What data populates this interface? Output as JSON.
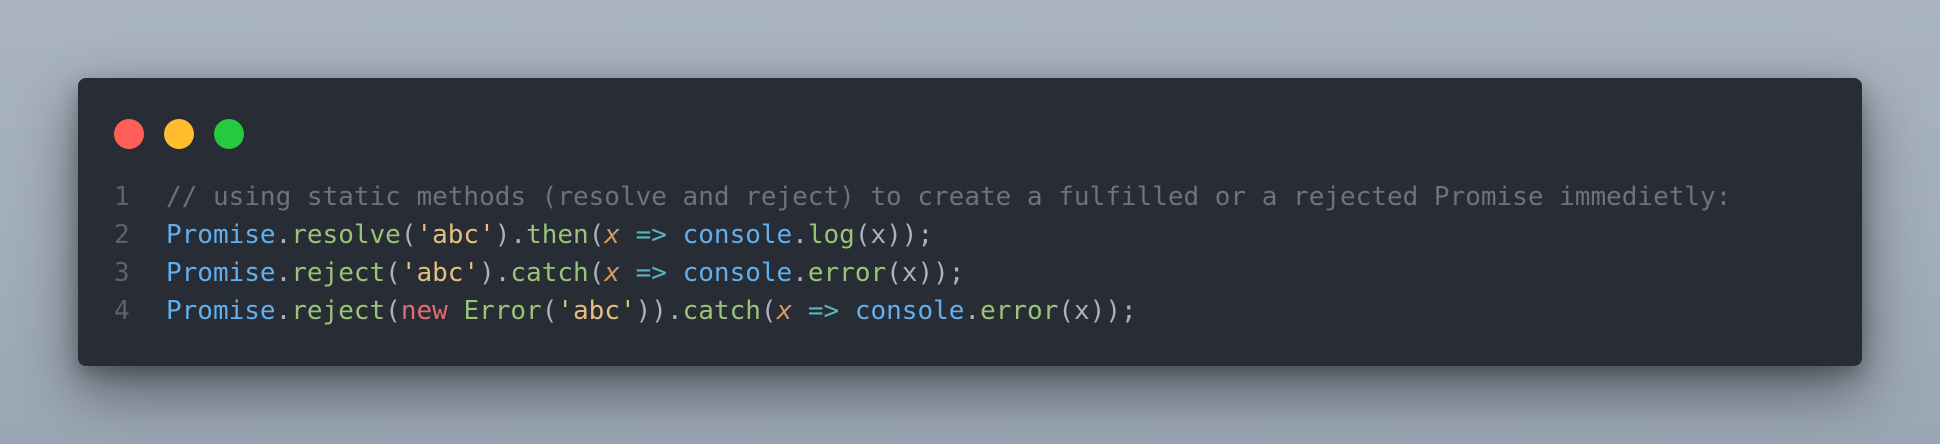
{
  "window": {
    "controls": [
      "close",
      "minimize",
      "zoom"
    ],
    "colors": {
      "background": "#282c34",
      "close": "#ff5f56",
      "minimize": "#ffbd2e",
      "zoom": "#27c93f"
    }
  },
  "code": {
    "language": "javascript",
    "lines": [
      {
        "number": "1",
        "tokens": [
          {
            "type": "comment",
            "text": "// using static methods (resolve and reject) to create a fulfilled or a rejected Promise immedietly:"
          }
        ]
      },
      {
        "number": "2",
        "tokens": [
          {
            "type": "class",
            "text": "Promise"
          },
          {
            "type": "plain",
            "text": "."
          },
          {
            "type": "method",
            "text": "resolve"
          },
          {
            "type": "plain",
            "text": "("
          },
          {
            "type": "string",
            "text": "'abc'"
          },
          {
            "type": "plain",
            "text": ")."
          },
          {
            "type": "method",
            "text": "then"
          },
          {
            "type": "plain",
            "text": "("
          },
          {
            "type": "param",
            "text": "x"
          },
          {
            "type": "plain",
            "text": " "
          },
          {
            "type": "op",
            "text": "=>"
          },
          {
            "type": "plain",
            "text": " "
          },
          {
            "type": "class",
            "text": "console"
          },
          {
            "type": "plain",
            "text": "."
          },
          {
            "type": "method",
            "text": "log"
          },
          {
            "type": "plain",
            "text": "(x));"
          }
        ]
      },
      {
        "number": "3",
        "tokens": [
          {
            "type": "class",
            "text": "Promise"
          },
          {
            "type": "plain",
            "text": "."
          },
          {
            "type": "method",
            "text": "reject"
          },
          {
            "type": "plain",
            "text": "("
          },
          {
            "type": "string",
            "text": "'abc'"
          },
          {
            "type": "plain",
            "text": ")."
          },
          {
            "type": "method",
            "text": "catch"
          },
          {
            "type": "plain",
            "text": "("
          },
          {
            "type": "param",
            "text": "x"
          },
          {
            "type": "plain",
            "text": " "
          },
          {
            "type": "op",
            "text": "=>"
          },
          {
            "type": "plain",
            "text": " "
          },
          {
            "type": "class",
            "text": "console"
          },
          {
            "type": "plain",
            "text": "."
          },
          {
            "type": "method",
            "text": "error"
          },
          {
            "type": "plain",
            "text": "(x));"
          }
        ]
      },
      {
        "number": "4",
        "tokens": [
          {
            "type": "class",
            "text": "Promise"
          },
          {
            "type": "plain",
            "text": "."
          },
          {
            "type": "method",
            "text": "reject"
          },
          {
            "type": "plain",
            "text": "("
          },
          {
            "type": "keyword",
            "text": "new"
          },
          {
            "type": "plain",
            "text": " "
          },
          {
            "type": "method",
            "text": "Error"
          },
          {
            "type": "plain",
            "text": "("
          },
          {
            "type": "string",
            "text": "'abc'"
          },
          {
            "type": "plain",
            "text": "))."
          },
          {
            "type": "method",
            "text": "catch"
          },
          {
            "type": "plain",
            "text": "("
          },
          {
            "type": "param",
            "text": "x"
          },
          {
            "type": "plain",
            "text": " "
          },
          {
            "type": "op",
            "text": "=>"
          },
          {
            "type": "plain",
            "text": " "
          },
          {
            "type": "class",
            "text": "console"
          },
          {
            "type": "plain",
            "text": "."
          },
          {
            "type": "method",
            "text": "error"
          },
          {
            "type": "plain",
            "text": "(x));"
          }
        ]
      }
    ]
  }
}
